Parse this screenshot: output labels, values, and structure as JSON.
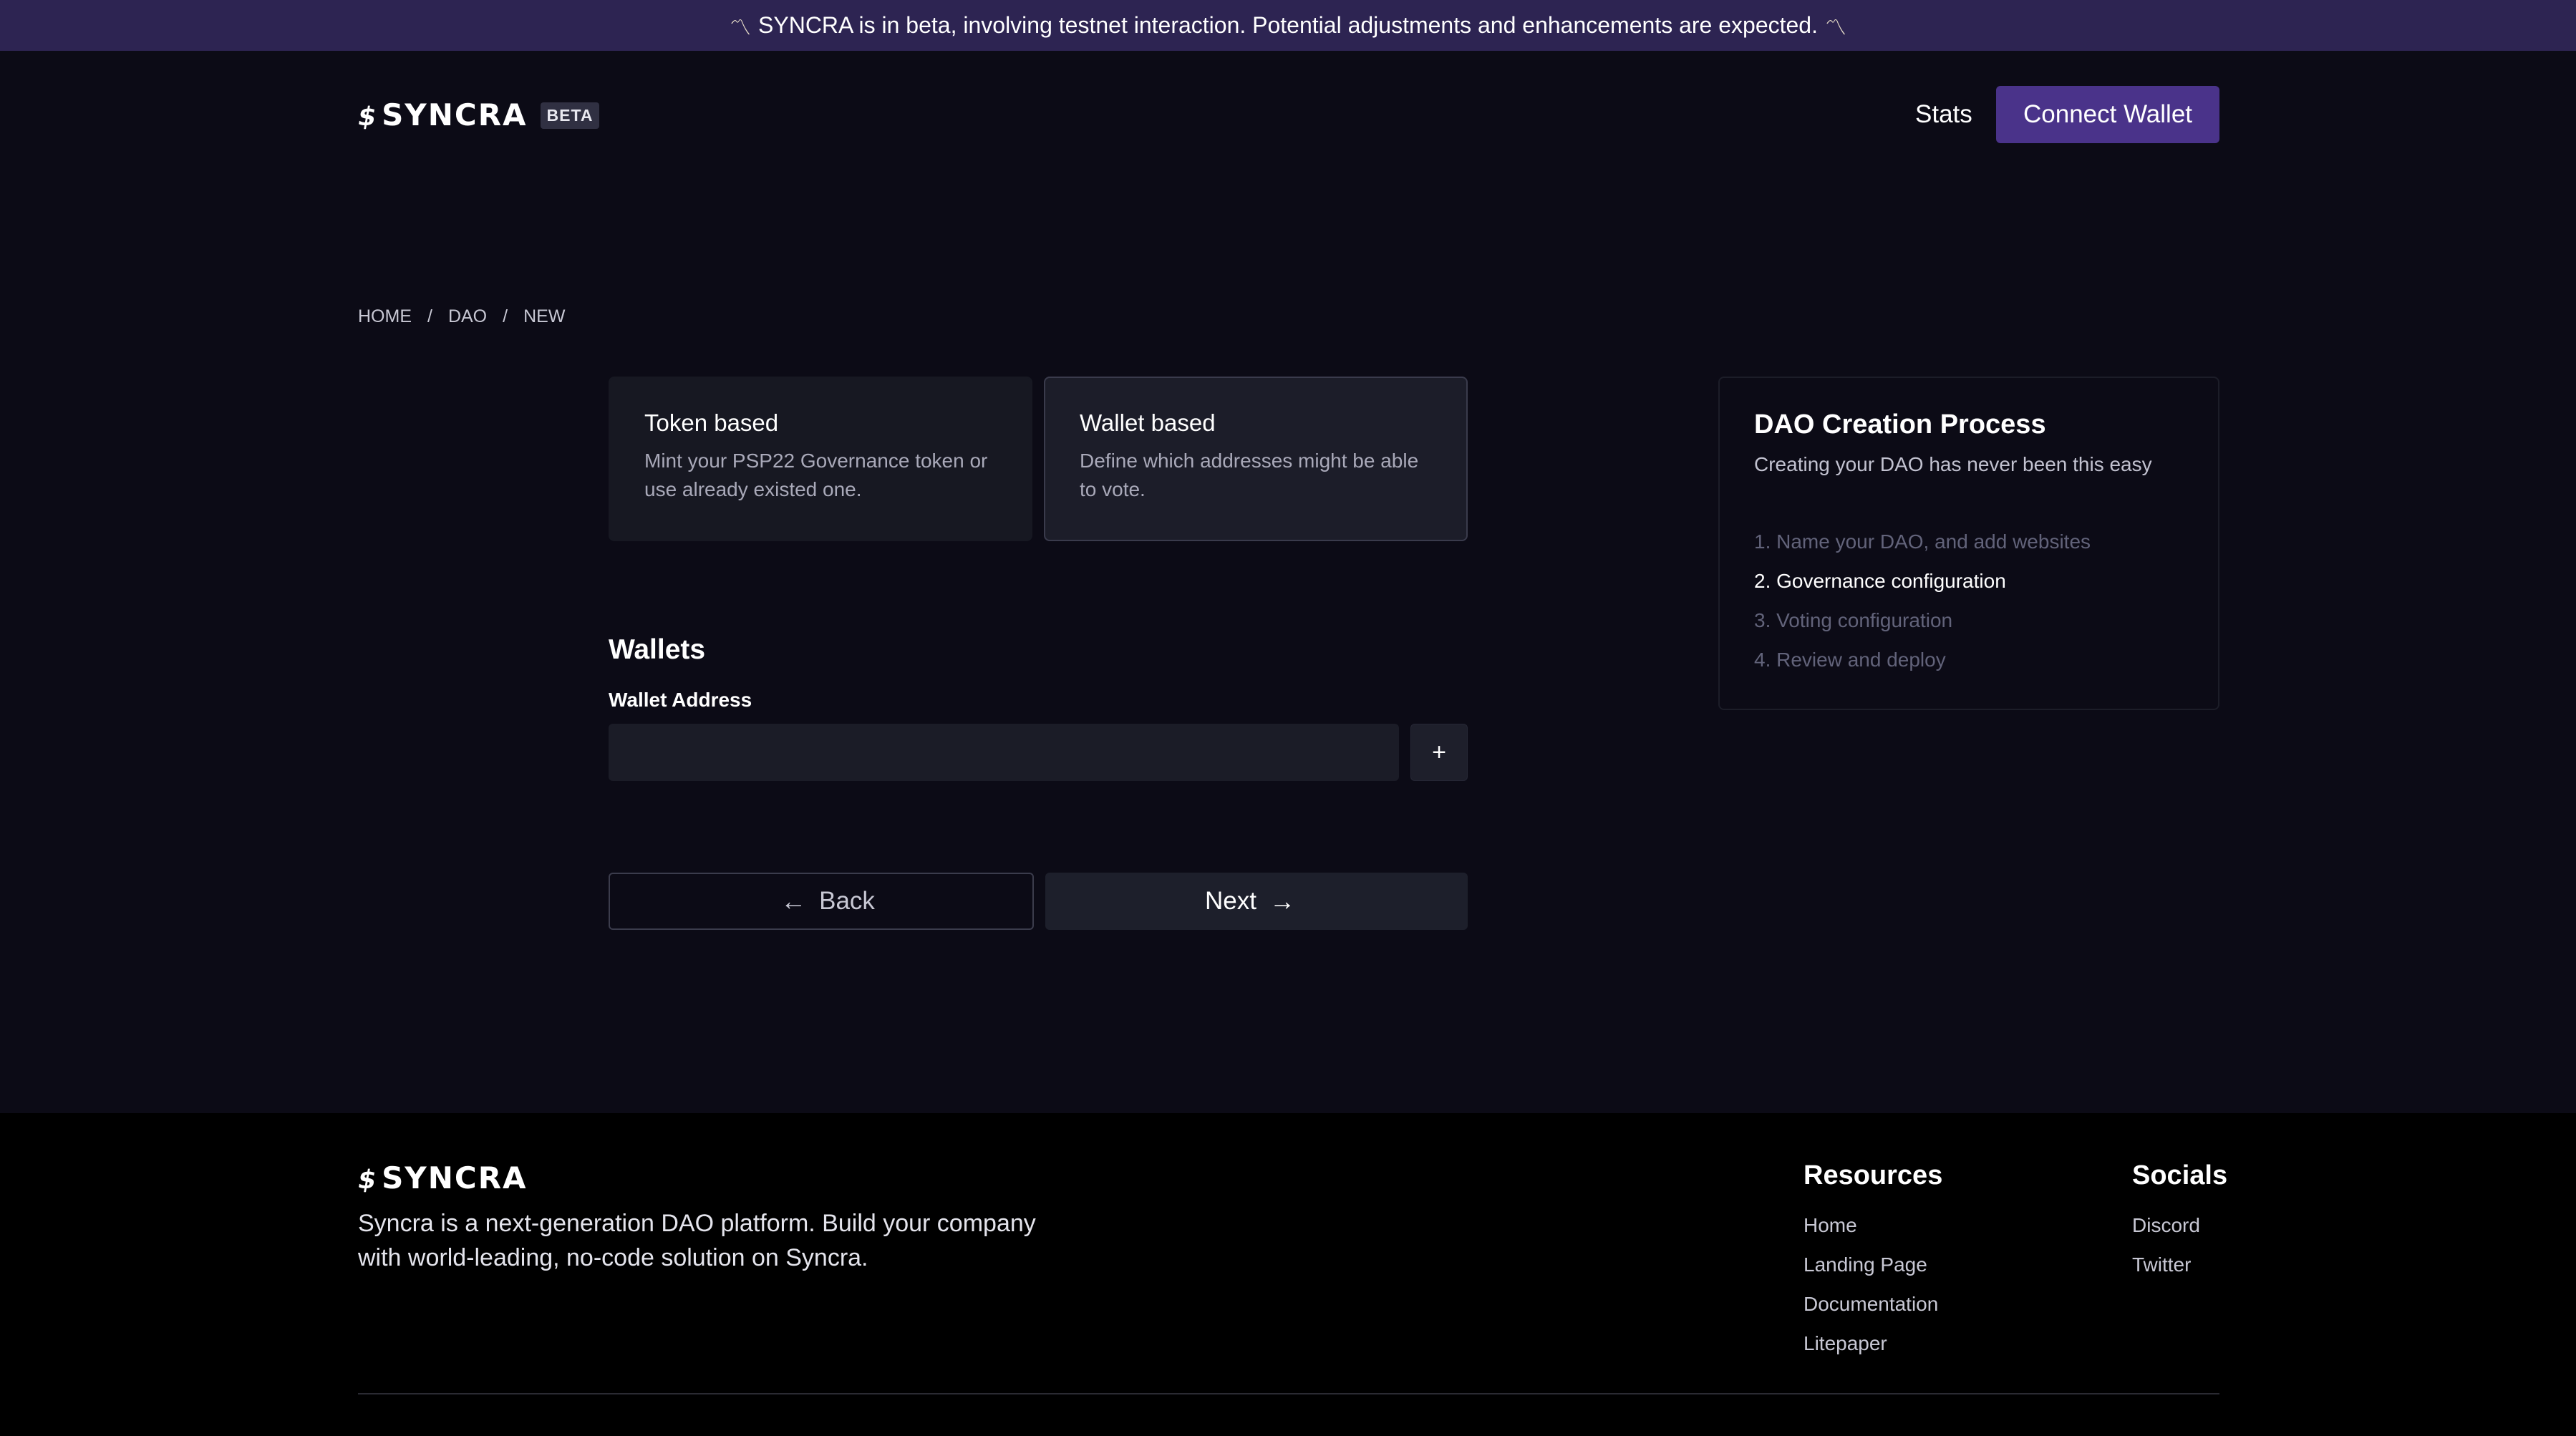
{
  "banner": {
    "emoji_left": "〽",
    "text": "SYNCRA is in beta, involving testnet interaction. Potential adjustments and enhancements are expected.",
    "emoji_right": "〽"
  },
  "header": {
    "logo_text": "SYNCRA",
    "beta_label": "BETA",
    "nav_stats": "Stats",
    "connect_wallet": "Connect Wallet"
  },
  "breadcrumb": {
    "items": [
      "HOME",
      "DAO",
      "NEW"
    ],
    "separator": "/"
  },
  "type_cards": [
    {
      "title": "Token based",
      "description": "Mint your PSP22 Governance token or use already existed one."
    },
    {
      "title": "Wallet based",
      "description": "Define which addresses might be able to vote."
    }
  ],
  "wallets": {
    "title": "Wallets",
    "address_label": "Wallet Address",
    "address_value": "",
    "add_label": "+"
  },
  "actions": {
    "back_label": "Back",
    "next_label": "Next"
  },
  "process": {
    "title": "DAO Creation Process",
    "subtitle": "Creating your DAO has never been this easy",
    "steps": [
      "1. Name your DAO, and add websites",
      "2. Governance configuration",
      "3. Voting configuration",
      "4. Review and deploy"
    ],
    "active_step": 2
  },
  "footer": {
    "logo_text": "SYNCRA",
    "description": "Syncra is a next-generation DAO platform. Build your company with world-leading, no-code solution on Syncra.",
    "resources": {
      "title": "Resources",
      "links": [
        "Home",
        "Landing Page",
        "Documentation",
        "Litepaper"
      ]
    },
    "socials": {
      "title": "Socials",
      "links": [
        "Discord",
        "Twitter"
      ]
    }
  },
  "colors": {
    "background": "#0c0b16",
    "banner": "#2d2452",
    "accent": "#4a338a",
    "footer": "#000000"
  }
}
